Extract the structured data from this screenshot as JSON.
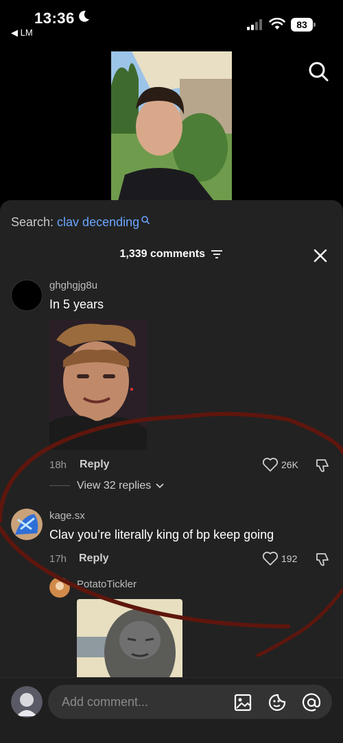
{
  "status": {
    "time": "13:36",
    "back_app": "◀ LM",
    "battery": "83"
  },
  "search": {
    "prefix": "Search: ",
    "term": "clav decending"
  },
  "comments_header": {
    "count_label": "1,339 comments"
  },
  "comments": [
    {
      "username": "ghghgjg8u",
      "text": "In 5 years",
      "age": "18h",
      "reply_label": "Reply",
      "likes": "26K",
      "view_replies": "View 32 replies"
    },
    {
      "username": "kage.sx",
      "text": "Clav you’re literally king of bp keep going",
      "age": "17h",
      "reply_label": "Reply",
      "likes": "192"
    },
    {
      "username": "PotatoTickler"
    }
  ],
  "composer": {
    "placeholder": "Add comment..."
  },
  "colors": {
    "accent_link": "#6aa6ff",
    "sheet_bg": "#222222",
    "annotation": "#6b1a10"
  },
  "icons": [
    "moon-icon",
    "signal-icon",
    "wifi-icon",
    "search-icon",
    "filter-icon",
    "close-icon",
    "heart-icon",
    "dislike-icon",
    "image-icon",
    "sticker-icon",
    "at-icon",
    "chevron-down-icon"
  ]
}
